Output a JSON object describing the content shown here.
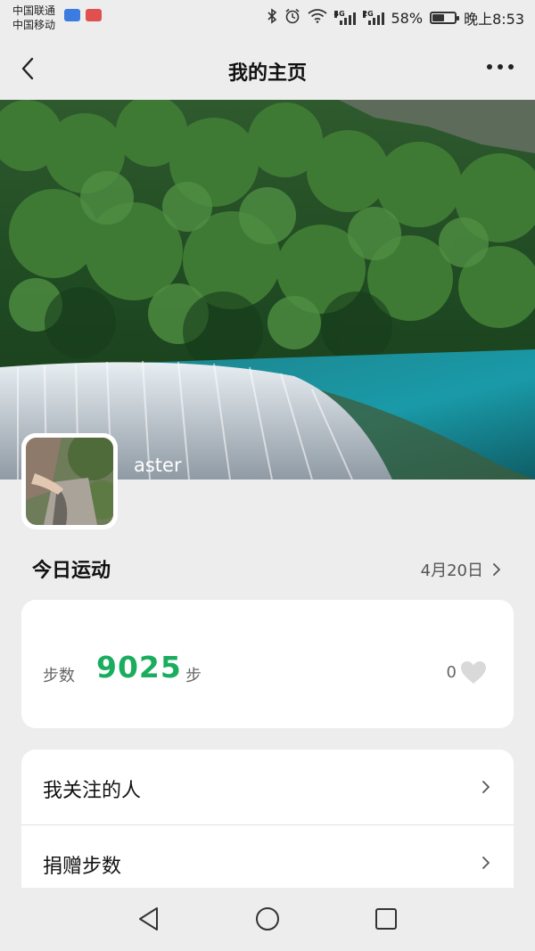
{
  "status_bar": {
    "carrier_1": "中国联通",
    "carrier_2": "中国移动",
    "net_1": "4G",
    "net_2": "2G",
    "battery": "58%",
    "battery_level": 0.58,
    "time": "晚上8:53",
    "icons": [
      "bluetooth-icon",
      "alarm-icon",
      "wifi-icon",
      "signal-icon",
      "battery-icon"
    ]
  },
  "nav": {
    "title": "我的主页",
    "back_icon": "chevron-left-icon",
    "more_icon": "more-icon"
  },
  "profile": {
    "username": "aster"
  },
  "today": {
    "title": "今日运动",
    "date": "4月20日",
    "steps_label": "步数",
    "steps_value": "9025",
    "steps_unit": "步",
    "likes": "0"
  },
  "menu": {
    "items": [
      {
        "label": "我关注的人"
      },
      {
        "label": "捐赠步数"
      }
    ]
  },
  "colors": {
    "accent": "#1aad5e",
    "background": "#ededed",
    "card": "#ffffff"
  }
}
